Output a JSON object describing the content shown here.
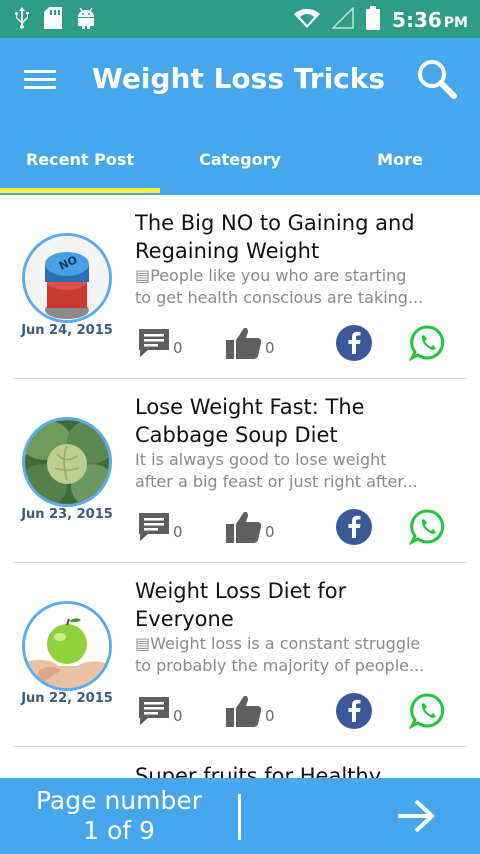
{
  "status_bar": {
    "time": "5:36",
    "ampm": "PM",
    "icons": [
      "usb-icon",
      "sd-card-icon",
      "android-icon",
      "wifi-icon",
      "signal-icon",
      "battery-icon"
    ]
  },
  "app_bar": {
    "title": "Weight Loss Tricks",
    "menu_icon": "hamburger-menu-icon",
    "search_icon": "search-icon",
    "background": "#47a7ec"
  },
  "tabs": {
    "items": [
      {
        "label": "Recent Post"
      },
      {
        "label": "Category"
      },
      {
        "label": "More"
      }
    ],
    "active_index": 0,
    "indicator_color": "#ffee33"
  },
  "posts": [
    {
      "title_lines": [
        "The Big NO to Gaining and",
        "Regaining Weight"
      ],
      "excerpt_lines": [
        "▤People like you who are starting",
        "to get health conscious are taking..."
      ],
      "date": "Jun 24, 2015",
      "comments": "0",
      "likes": "0"
    },
    {
      "title_lines": [
        "Lose Weight Fast: The",
        "Cabbage Soup Diet"
      ],
      "excerpt_lines": [
        "It is always good to lose weight",
        "after a big feast or just right after..."
      ],
      "date": "Jun 23, 2015",
      "comments": "0",
      "likes": "0"
    },
    {
      "title_lines": [
        "Weight Loss Diet for",
        "Everyone"
      ],
      "excerpt_lines": [
        "▤Weight loss is a constant struggle",
        "to probably the majority of people..."
      ],
      "date": "Jun 22, 2015",
      "comments": "0",
      "likes": "0"
    },
    {
      "title_lines": [
        "Super fruits for Healthy"
      ]
    }
  ],
  "bottom_bar": {
    "page_label": "Page number",
    "page_value": "1 of 9",
    "next_icon": "arrow-right-icon"
  },
  "colors": {
    "status_bar": "#2e9c86",
    "accent": "#47a7ec",
    "facebook": "#3b5998",
    "whatsapp": "#25c440",
    "icon_gray": "#5f5f5f"
  }
}
